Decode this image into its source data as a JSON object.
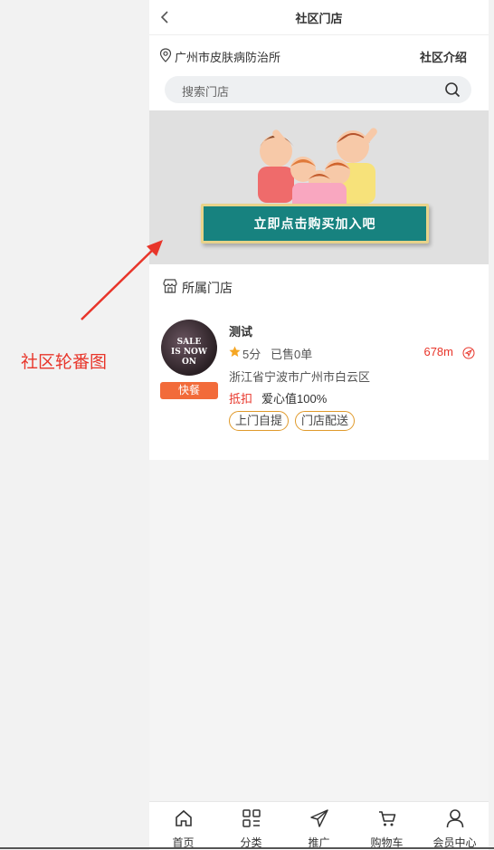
{
  "header": {
    "title": "社区门店"
  },
  "location": {
    "name": "广州市皮肤病防治所",
    "intro_label": "社区介绍"
  },
  "search": {
    "placeholder": "搜索门店"
  },
  "banner": {
    "button_text": "立即点击购买加入吧"
  },
  "stores_section": {
    "title": "所属门店",
    "stores": [
      {
        "name": "测试",
        "image_text": "SALE\nIS NOW ON",
        "category": "快餐",
        "score": "5分",
        "sold": "已售0单",
        "distance": "678m",
        "address": "浙江省宁波市广州市白云区",
        "deduct_label": "抵扣",
        "love_value": "爱心值100%",
        "tags": [
          "上门自提",
          "门店配送"
        ]
      }
    ]
  },
  "annotation": {
    "text": "社区轮番图"
  },
  "tabbar": {
    "items": [
      {
        "label": "首页",
        "icon": "home-icon"
      },
      {
        "label": "分类",
        "icon": "category-icon"
      },
      {
        "label": "推广",
        "icon": "paper-plane-icon"
      },
      {
        "label": "购物车",
        "icon": "cart-icon"
      },
      {
        "label": "会员中心",
        "icon": "user-icon"
      }
    ]
  },
  "colors": {
    "accent": "#e8352a",
    "badge": "#f26b3a",
    "tag_border": "#e09a2b",
    "banner_button": "#17827f"
  }
}
